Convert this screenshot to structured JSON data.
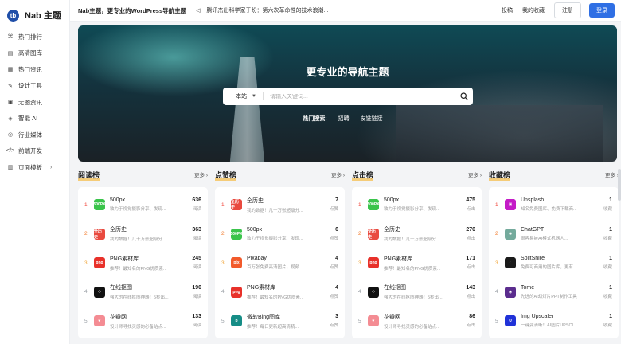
{
  "logo": {
    "badge": "tb",
    "text": "Nab 主题"
  },
  "sidebar": {
    "items": [
      {
        "icon": "⌘",
        "icon_name": "hot-rank-icon",
        "label": "热门排行"
      },
      {
        "icon": "▤",
        "icon_name": "image-icon",
        "label": "高清图库"
      },
      {
        "icon": "▦",
        "icon_name": "news-icon",
        "label": "热门资讯"
      },
      {
        "icon": "✎",
        "icon_name": "design-icon",
        "label": "设计工具"
      },
      {
        "icon": "▣",
        "icon_name": "article-icon",
        "label": "无图资讯"
      },
      {
        "icon": "◈",
        "icon_name": "ai-icon",
        "label": "智能 AI"
      },
      {
        "icon": "◎",
        "icon_name": "media-icon",
        "label": "行业媒体"
      },
      {
        "icon": "</>",
        "icon_name": "code-icon",
        "label": "前端开发"
      },
      {
        "icon": "▥",
        "icon_name": "template-icon",
        "label": "页面模板",
        "has_children": true
      }
    ]
  },
  "topbar": {
    "title": "Nab主题，更专业的WordPress导航主题",
    "news": "腾讯杰出科学家于盼：第六次革命性的技术浪潮...",
    "links": [
      "投稿",
      "我的收藏"
    ],
    "register": "注册",
    "login": "登录"
  },
  "hero": {
    "title": "更专业的导航主题",
    "search_scope": "本站",
    "search_placeholder": "请输入关键词...",
    "hot_label": "热门搜索:",
    "hot_links": [
      "招聘",
      "友链链接"
    ]
  },
  "rankings": [
    {
      "title": "阅读榜",
      "more": "更多",
      "unit": "阅读",
      "items": [
        {
          "rank": "1",
          "name": "500px",
          "desc": "致力于视觉摄影分享、发现...",
          "count": "636",
          "icon_text": "500PX",
          "color": "#3ac44b"
        },
        {
          "rank": "2",
          "name": "全历史",
          "desc": "我的数据！几十万张超级分...",
          "count": "363",
          "icon_text": "全历史",
          "color": "#e94a3f"
        },
        {
          "rank": "3",
          "name": "PNG素材库",
          "desc": "推荐！最知名的PNG优质素...",
          "count": "245",
          "icon_text": "png",
          "color": "#e8312a"
        },
        {
          "rank": "4",
          "name": "在线抠图",
          "desc": "强大的在线抠图神器！5秒出...",
          "count": "190",
          "icon_text": "⁘",
          "color": "#111111"
        },
        {
          "rank": "5",
          "name": "花瓣网",
          "desc": "设计师寻找灵感的必备站点...",
          "count": "133",
          "icon_text": "❦",
          "color": "#f48c93"
        }
      ]
    },
    {
      "title": "点赞榜",
      "more": "更多",
      "unit": "点赞",
      "items": [
        {
          "rank": "1",
          "name": "全历史",
          "desc": "我的数据！几十万张超级分...",
          "count": "7",
          "icon_text": "全历史",
          "color": "#e94a3f"
        },
        {
          "rank": "2",
          "name": "500px",
          "desc": "致力于视觉摄影分享、发现...",
          "count": "6",
          "icon_text": "500PX",
          "color": "#3ac44b"
        },
        {
          "rank": "3",
          "name": "Pixabay",
          "desc": "百万张免费高清图片，视频...",
          "count": "4",
          "icon_text": "pix",
          "color": "#f25a2b"
        },
        {
          "rank": "4",
          "name": "PNG素材库",
          "desc": "推荐！最知名的PNG优质素...",
          "count": "4",
          "icon_text": "png",
          "color": "#e8312a"
        },
        {
          "rank": "5",
          "name": "微软Bing图库",
          "desc": "推荐！每日更新超高清精...",
          "count": "3",
          "icon_text": "b",
          "color": "#168d86"
        }
      ]
    },
    {
      "title": "点击榜",
      "more": "更多",
      "unit": "点击",
      "items": [
        {
          "rank": "1",
          "name": "500px",
          "desc": "致力于视觉摄影分享、发现...",
          "count": "475",
          "icon_text": "500PX",
          "color": "#3ac44b"
        },
        {
          "rank": "2",
          "name": "全历史",
          "desc": "我的数据！几十万张超级分...",
          "count": "270",
          "icon_text": "全历史",
          "color": "#e94a3f"
        },
        {
          "rank": "3",
          "name": "PNG素材库",
          "desc": "推荐！最知名的PNG优质素...",
          "count": "171",
          "icon_text": "png",
          "color": "#e8312a"
        },
        {
          "rank": "4",
          "name": "在线抠图",
          "desc": "强大的在线抠图神器！5秒出...",
          "count": "143",
          "icon_text": "⁘",
          "color": "#111111"
        },
        {
          "rank": "5",
          "name": "花瓣网",
          "desc": "设计师寻找灵感的必备站点...",
          "count": "86",
          "icon_text": "❦",
          "color": "#f48c93"
        }
      ]
    },
    {
      "title": "收藏榜",
      "more": "更多",
      "unit": "收藏",
      "items": [
        {
          "rank": "1",
          "name": "Unsplash",
          "desc": "知名免费图库、免费下载商...",
          "count": "1",
          "icon_text": "▣",
          "color": "#c41cc7"
        },
        {
          "rank": "2",
          "name": "ChatGPT",
          "desc": "很容易被AI模式机器人...",
          "count": "1",
          "icon_text": "✺",
          "color": "#74aa9c"
        },
        {
          "rank": "3",
          "name": "SplitShire",
          "desc": "免费可商用的图片库，更有...",
          "count": "1",
          "icon_text": "◐",
          "color": "#1a1a1a"
        },
        {
          "rank": "4",
          "name": "Tome",
          "desc": "先进的AI幻灯片PPT制作工具",
          "count": "1",
          "icon_text": "◉",
          "color": "#5b2d8e"
        },
        {
          "rank": "5",
          "name": "Img Upscaler",
          "desc": "一键变清晰！AI图片UPSCL...",
          "count": "1",
          "icon_text": "U",
          "color": "#2032d8"
        }
      ]
    }
  ],
  "colors": {
    "accent": "#2f6fe4",
    "rank_1": "#f2463b",
    "rank_2": "#f27a2b",
    "rank_3": "#f0a12e",
    "rank_other": "#9aa0a6"
  }
}
